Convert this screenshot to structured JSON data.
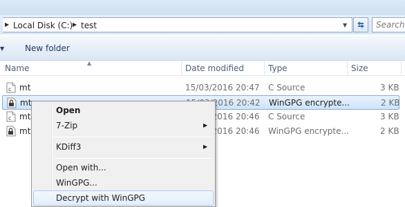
{
  "address": {
    "crumbs": [
      "Local Disk (C:)",
      "test"
    ],
    "search_placeholder": "Search"
  },
  "toolbar": {
    "new_folder_label": "New folder"
  },
  "columns": {
    "name": "Name",
    "date": "Date modified",
    "type": "Type",
    "size": "Size"
  },
  "files": [
    {
      "name": "mt",
      "date": "15/03/2016 20:47",
      "type": "C Source",
      "size": "3 KB",
      "icon": "c-source-file-icon"
    },
    {
      "name": "mt.",
      "date": "15/03/2016 20:42",
      "type": "WinGPG encrypte...",
      "size": "2 KB",
      "icon": "gpg-encrypted-file-icon"
    },
    {
      "name": "mt-",
      "date": "15/03/2016 20:46",
      "type": "C Source",
      "size": "3 KB",
      "icon": "c-source-file-icon"
    },
    {
      "name": "mt-",
      "date": "15/03/2016 20:46",
      "type": "WinGPG encrypte...",
      "size": "2 KB",
      "icon": "gpg-encrypted-file-icon"
    }
  ],
  "context_menu": {
    "open": "Open",
    "zip": "7-Zip",
    "kdiff": "KDiff3",
    "open_with": "Open with...",
    "wingpg": "WinGPG...",
    "decrypt": "Decrypt with WinGPG"
  }
}
